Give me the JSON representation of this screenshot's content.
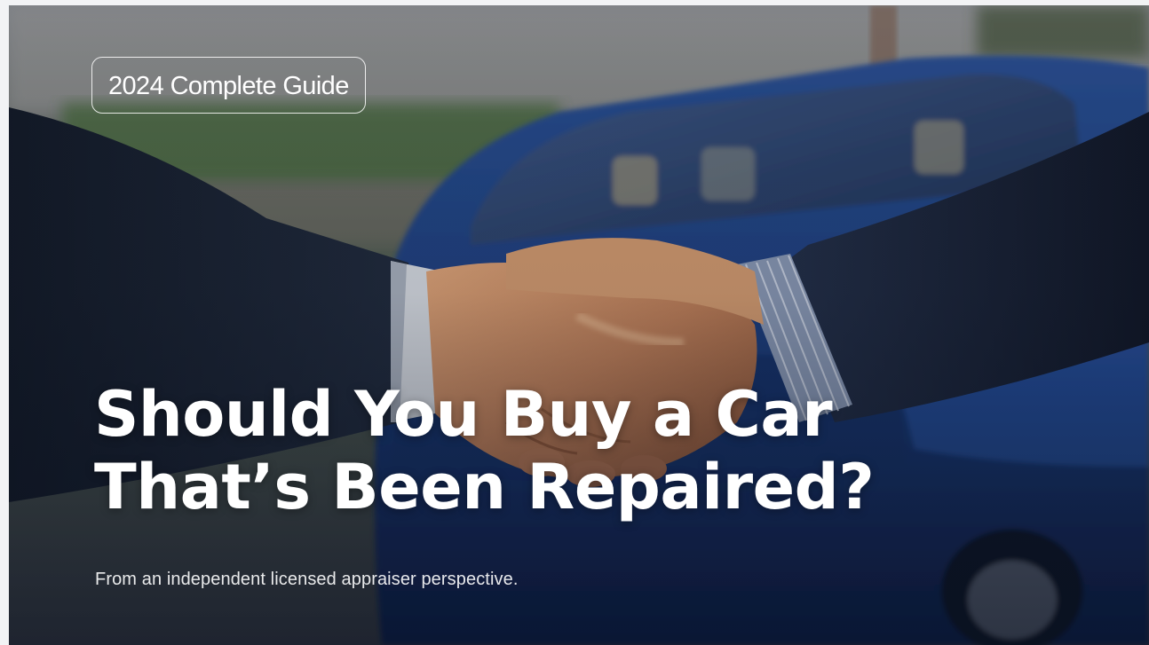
{
  "hero": {
    "badge_label": "2024 Complete Guide",
    "title_line_1": "Should You Buy a Car",
    "title_line_2": "That’s Been Repaired?",
    "subtitle": "From an independent licensed appraiser perspective."
  },
  "colors": {
    "text": "#ffffff",
    "car_blue": "#1f4a9c",
    "suit_navy": "#1c2535",
    "skin": "#c58a5f"
  }
}
